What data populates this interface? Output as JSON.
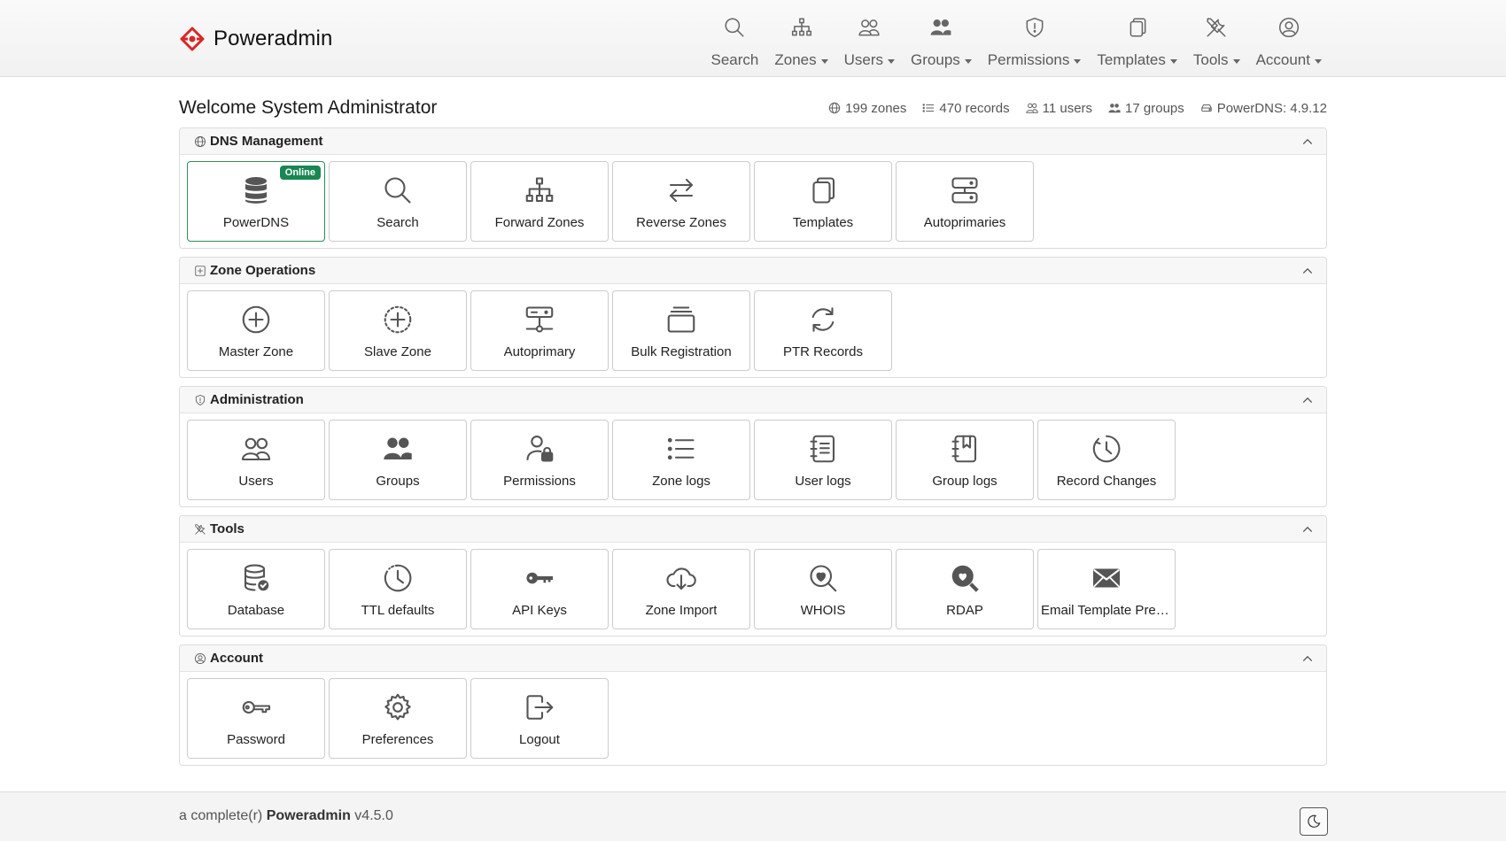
{
  "brand": {
    "name": "Poweradmin"
  },
  "nav": [
    {
      "label": "Search",
      "icon": "search-icon",
      "dropdown": false
    },
    {
      "label": "Zones",
      "icon": "zones-icon",
      "dropdown": true
    },
    {
      "label": "Users",
      "icon": "users-icon",
      "dropdown": true
    },
    {
      "label": "Groups",
      "icon": "groups-icon",
      "dropdown": true
    },
    {
      "label": "Permissions",
      "icon": "shield-icon",
      "dropdown": true
    },
    {
      "label": "Templates",
      "icon": "templates-icon",
      "dropdown": true
    },
    {
      "label": "Tools",
      "icon": "tools-icon",
      "dropdown": true
    },
    {
      "label": "Account",
      "icon": "account-icon",
      "dropdown": true
    }
  ],
  "welcome": "Welcome System Administrator",
  "stats": {
    "zones": "199 zones",
    "records": "470 records",
    "users": "11 users",
    "groups": "17 groups",
    "powerdns": "PowerDNS: 4.9.12"
  },
  "sections": [
    {
      "title": "DNS Management",
      "icon": "globe-icon",
      "tiles": [
        {
          "label": "PowerDNS",
          "icon": "database-icon",
          "badge": "Online"
        },
        {
          "label": "Search",
          "icon": "search-icon"
        },
        {
          "label": "Forward Zones",
          "icon": "sitemap-icon"
        },
        {
          "label": "Reverse Zones",
          "icon": "arrows-left-right-icon"
        },
        {
          "label": "Templates",
          "icon": "templates-icon"
        },
        {
          "label": "Autoprimaries",
          "icon": "servers-icon"
        }
      ]
    },
    {
      "title": "Zone Operations",
      "icon": "plus-square-icon",
      "tiles": [
        {
          "label": "Master Zone",
          "icon": "plus-circle-icon"
        },
        {
          "label": "Slave Zone",
          "icon": "plus-circle-dotted-icon"
        },
        {
          "label": "Autoprimary",
          "icon": "hdd-network-icon"
        },
        {
          "label": "Bulk Registration",
          "icon": "collection-icon"
        },
        {
          "label": "PTR Records",
          "icon": "refresh-icon"
        }
      ]
    },
    {
      "title": "Administration",
      "icon": "shield-icon",
      "tiles": [
        {
          "label": "Users",
          "icon": "users-icon"
        },
        {
          "label": "Groups",
          "icon": "groups-icon"
        },
        {
          "label": "Permissions",
          "icon": "person-lock-icon"
        },
        {
          "label": "Zone logs",
          "icon": "list-icon"
        },
        {
          "label": "User logs",
          "icon": "journal-text-icon"
        },
        {
          "label": "Group logs",
          "icon": "journal-bookmark-icon"
        },
        {
          "label": "Record Changes",
          "icon": "clock-history-icon"
        }
      ]
    },
    {
      "title": "Tools",
      "icon": "tools-icon",
      "tiles": [
        {
          "label": "Database",
          "icon": "database-check-icon"
        },
        {
          "label": "TTL defaults",
          "icon": "clock-icon"
        },
        {
          "label": "API Keys",
          "icon": "key-fill-icon"
        },
        {
          "label": "Zone Import",
          "icon": "cloud-download-icon"
        },
        {
          "label": "WHOIS",
          "icon": "search-heart-icon"
        },
        {
          "label": "RDAP",
          "icon": "search-heart-fill-icon"
        },
        {
          "label": "Email Template Previ...",
          "icon": "envelope-icon"
        }
      ]
    },
    {
      "title": "Account",
      "icon": "account-icon",
      "tiles": [
        {
          "label": "Password",
          "icon": "key-icon"
        },
        {
          "label": "Preferences",
          "icon": "gear-icon"
        },
        {
          "label": "Logout",
          "icon": "logout-icon"
        }
      ]
    }
  ],
  "footer": {
    "prefix": "a complete(r)",
    "product": "Poweradmin",
    "version": "v4.5.0"
  },
  "colors": {
    "online_badge": "#198754",
    "brand_red": "#d62828",
    "active_tile_border": "#2e8b57"
  }
}
